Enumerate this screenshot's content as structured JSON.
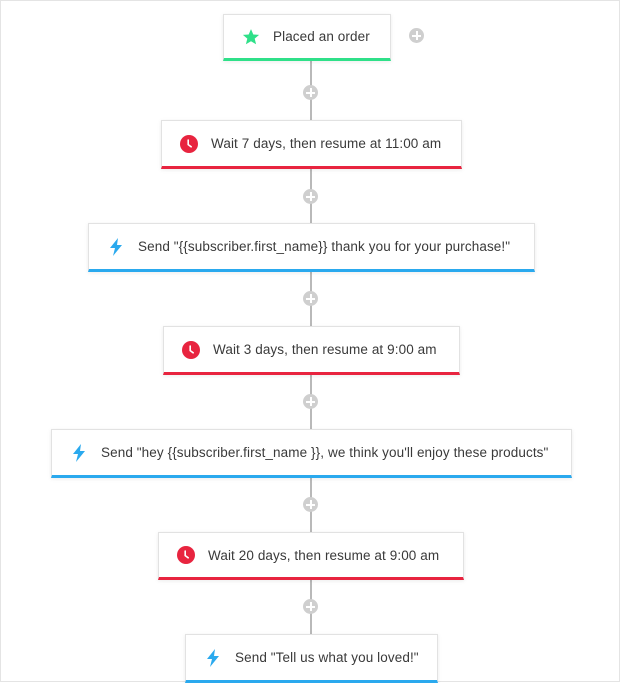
{
  "colors": {
    "trigger": "#2fe089",
    "wait": "#e8243f",
    "send": "#2aa9ee",
    "connector": "#b9b9b9",
    "add": "#cfcfcf"
  },
  "workflow": {
    "steps": [
      {
        "type": "trigger",
        "icon": "star-icon",
        "label": "Placed an order"
      },
      {
        "type": "wait",
        "icon": "clock-icon",
        "label": "Wait 7 days, then resume at 11:00 am"
      },
      {
        "type": "send",
        "icon": "lightning-icon",
        "label": "Send \"{{subscriber.first_name}} thank you for your purchase!\""
      },
      {
        "type": "wait",
        "icon": "clock-icon",
        "label": "Wait 3 days, then resume at 9:00 am"
      },
      {
        "type": "send",
        "icon": "lightning-icon",
        "label": "Send \"hey {{subscriber.first_name }}, we think you'll enjoy these products\""
      },
      {
        "type": "wait",
        "icon": "clock-icon",
        "label": "Wait 20 days, then resume at 9:00 am"
      },
      {
        "type": "send",
        "icon": "lightning-icon",
        "label": "Send \"Tell us what you loved!\""
      }
    ]
  }
}
